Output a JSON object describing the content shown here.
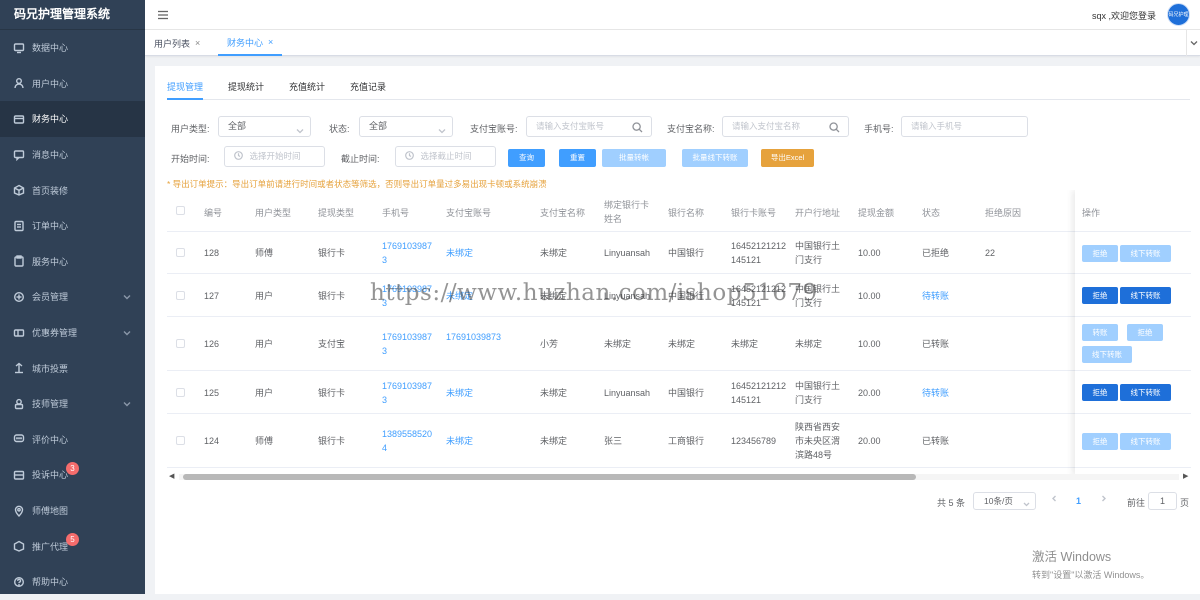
{
  "app": {
    "title": "码兄护理管理系统"
  },
  "sidebar": {
    "items": [
      {
        "label": "数据中心",
        "icon": "monitor-icon"
      },
      {
        "label": "用户中心",
        "icon": "user-icon"
      },
      {
        "label": "财务中心",
        "icon": "wallet-icon",
        "active": true
      },
      {
        "label": "消息中心",
        "icon": "message-icon"
      },
      {
        "label": "首页装修",
        "icon": "cube-icon"
      },
      {
        "label": "订单中心",
        "icon": "order-icon"
      },
      {
        "label": "服务中心",
        "icon": "clipboard-icon"
      },
      {
        "label": "会员管理",
        "icon": "member-icon",
        "expandable": true
      },
      {
        "label": "优惠券管理",
        "icon": "coupon-icon",
        "expandable": true
      },
      {
        "label": "城市投票",
        "icon": "vote-icon"
      },
      {
        "label": "技师管理",
        "icon": "technician-icon",
        "expandable": true
      },
      {
        "label": "评价中心",
        "icon": "comment-icon"
      },
      {
        "label": "投诉中心",
        "icon": "complaint-icon",
        "badge": "3"
      },
      {
        "label": "师傅地图",
        "icon": "location-icon"
      },
      {
        "label": "推广代理",
        "icon": "promote-icon",
        "badge": "5"
      },
      {
        "label": "帮助中心",
        "icon": "help-icon"
      }
    ]
  },
  "header": {
    "welcome": "sqx ,欢迎您登录",
    "avatar_text": "码兄护理"
  },
  "tabs": [
    {
      "label": "用户列表",
      "close": "×"
    },
    {
      "label": "财务中心",
      "close": "×",
      "active": true
    }
  ],
  "subtabs": [
    "提现管理",
    "提现统计",
    "充值统计",
    "充值记录"
  ],
  "filters": {
    "user_type_label": "用户类型:",
    "user_type_value": "全部",
    "status_label": "状态:",
    "status_value": "全部",
    "alipay_account_label": "支付宝账号:",
    "alipay_account_placeholder": "请输入支付宝账号",
    "alipay_name_label": "支付宝名称:",
    "alipay_name_placeholder": "请输入支付宝名称",
    "phone_label": "手机号:",
    "phone_placeholder": "请输入手机号",
    "start_label": "开始时间:",
    "start_placeholder": "选择开始时间",
    "end_label": "截止时间:",
    "end_placeholder": "选择截止时间"
  },
  "buttons": {
    "query": "查询",
    "reset": "重置",
    "batch_transfer": "批量转帐",
    "batch_offline": "批量线下转账",
    "export": "导出Excel"
  },
  "tip": "* 导出订单提示：导出订单前请进行时间或者状态等筛选，否则导出订单量过多易出现卡顿或系统崩溃",
  "table": {
    "headers": [
      "编号",
      "用户类型",
      "提现类型",
      "手机号",
      "支付宝账号",
      "支付宝名称",
      "绑定银行卡姓名",
      "银行名称",
      "银行卡账号",
      "开户行地址",
      "提现金额",
      "状态",
      "拒绝原因",
      "操作"
    ],
    "rows": [
      {
        "id": "128",
        "user_type": "师傅",
        "withdraw_type": "银行卡",
        "phone": "17691039873",
        "alipay_account": "未绑定",
        "alipay_name": "未绑定",
        "card_name": "Linyuansah",
        "bank": "中国银行",
        "card_no": "16452121212145121",
        "branch": "中国银行土门支行",
        "amount": "10.00",
        "status": "已拒绝",
        "reason": "22",
        "ops": [
          "拒绝",
          "线下转账"
        ],
        "ops_style": "light"
      },
      {
        "id": "127",
        "user_type": "用户",
        "withdraw_type": "银行卡",
        "phone": "17691039873",
        "alipay_account": "未绑定",
        "alipay_name": "未绑定",
        "card_name": "Linyuansah",
        "bank": "中国银行",
        "card_no": "16452121212145121",
        "branch": "中国银行土门支行",
        "amount": "10.00",
        "status": "待转账",
        "reason": "",
        "ops": [
          "拒绝",
          "线下转账"
        ],
        "ops_style": "primary"
      },
      {
        "id": "126",
        "user_type": "用户",
        "withdraw_type": "支付宝",
        "phone": "17691039873",
        "alipay_account": "17691039873",
        "alipay_name": "小芳",
        "card_name": "未绑定",
        "bank": "未绑定",
        "card_no": "未绑定",
        "branch": "未绑定",
        "amount": "10.00",
        "status": "已转账",
        "reason": "",
        "ops": [
          "转账",
          "拒绝",
          "线下转账"
        ],
        "ops_style": "light"
      },
      {
        "id": "125",
        "user_type": "用户",
        "withdraw_type": "银行卡",
        "phone": "17691039873",
        "alipay_account": "未绑定",
        "alipay_name": "未绑定",
        "card_name": "Linyuansah",
        "bank": "中国银行",
        "card_no": "16452121212145121",
        "branch": "中国银行土门支行",
        "amount": "20.00",
        "status": "待转账",
        "reason": "",
        "ops": [
          "拒绝",
          "线下转账"
        ],
        "ops_style": "primary"
      },
      {
        "id": "124",
        "user_type": "师傅",
        "withdraw_type": "银行卡",
        "phone": "13895585204",
        "alipay_account": "未绑定",
        "alipay_name": "未绑定",
        "card_name": "张三",
        "bank": "工商银行",
        "card_no": "123456789",
        "branch": "陕西省西安市未央区渭滨路48号",
        "amount": "20.00",
        "status": "已转账",
        "reason": "",
        "ops": [
          "拒绝",
          "线下转账"
        ],
        "ops_style": "light"
      }
    ]
  },
  "pagination": {
    "total": "共 5 条",
    "page_size": "10条/页",
    "current": "1",
    "goto_label": "前往",
    "goto_value": "1",
    "goto_suffix": "页"
  },
  "watermark": "https://www.huzhan.com/ishop51679",
  "activation": {
    "line1": "激活 Windows",
    "line2": "转到\"设置\"以激活 Windows。"
  },
  "colors": {
    "sidebar_bg": "#304156",
    "primary": "#409eff",
    "primary_dark": "#1e6fd9",
    "warning": "#e6a23c",
    "danger": "#f56c6c"
  }
}
